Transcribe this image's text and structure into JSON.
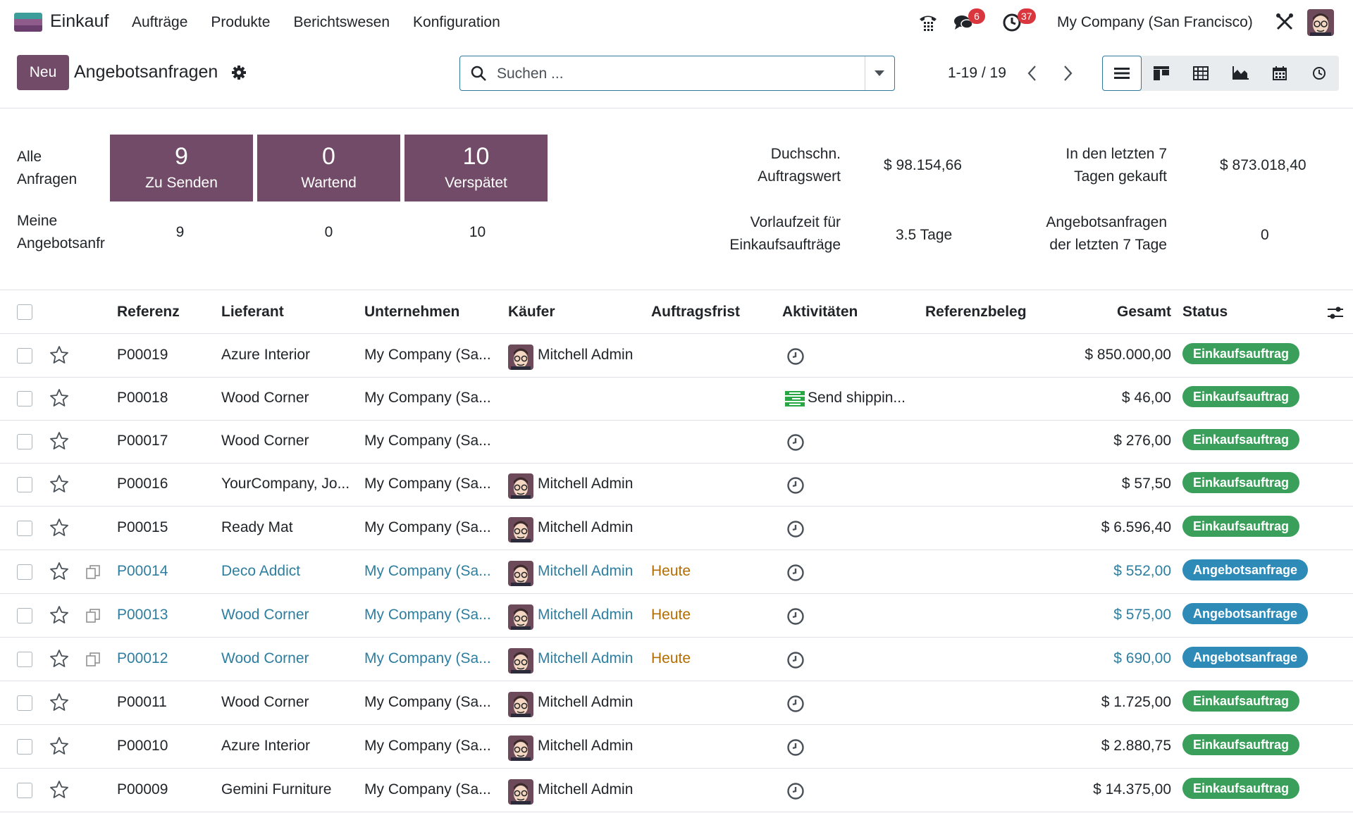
{
  "navbar": {
    "app_name": "Einkauf",
    "menu": [
      "Aufträge",
      "Produkte",
      "Berichtswesen",
      "Konfiguration"
    ],
    "chat_badge": "6",
    "activity_badge": "37",
    "company": "My Company (San Francisco)"
  },
  "control": {
    "new_label": "Neu",
    "title": "Angebotsanfragen",
    "search_placeholder": "Suchen ...",
    "pager": "1-19 / 19",
    "views": [
      "list-view-icon",
      "kanban-view-icon",
      "pivot-view-icon",
      "graph-view-icon",
      "calendar-view-icon",
      "activity-view-icon"
    ]
  },
  "dashboard": {
    "all_label_1": "Alle",
    "all_label_2": "Anfragen",
    "mine_label_1": "Meine",
    "mine_label_2": "Angebotsanfr",
    "tiles": [
      {
        "value": "9",
        "label": "Zu Senden"
      },
      {
        "value": "0",
        "label": "Wartend"
      },
      {
        "value": "10",
        "label": "Verspätet"
      }
    ],
    "mine_values": [
      "9",
      "0",
      "10"
    ],
    "kpis": {
      "avg_label_1": "Duchschn.",
      "avg_label_2": "Auftragswert",
      "avg_value": "$ 98.154,66",
      "bought_label_1": "In den letzten 7",
      "bought_label_2": "Tagen gekauft",
      "bought_value": "$ 873.018,40",
      "lead_label_1": "Vorlaufzeit für",
      "lead_label_2": "Einkaufsaufträge",
      "lead_value": "3.5 Tage",
      "rfq7_label_1": "Angebotsanfragen",
      "rfq7_label_2": "der letzten 7 Tage",
      "rfq7_value": "0"
    }
  },
  "table": {
    "headers": {
      "ref": "Referenz",
      "vendor": "Lieferant",
      "company": "Unternehmen",
      "buyer": "Käufer",
      "deadline": "Auftragsfrist",
      "activities": "Aktivitäten",
      "source": "Referenzbeleg",
      "total": "Gesamt",
      "status": "Status"
    },
    "rows": [
      {
        "ref": "P00019",
        "vendor": "Azure Interior",
        "company": "My Company (Sa...",
        "buyer": "Mitchell Admin",
        "deadline": "",
        "activity": "",
        "total": "$ 850.000,00",
        "status": "Einkaufsauftrag",
        "draft": false
      },
      {
        "ref": "P00018",
        "vendor": "Wood Corner",
        "company": "My Company (Sa...",
        "buyer": "",
        "deadline": "",
        "activity": "Send shippin...",
        "total": "$ 46,00",
        "status": "Einkaufsauftrag",
        "draft": false
      },
      {
        "ref": "P00017",
        "vendor": "Wood Corner",
        "company": "My Company (Sa...",
        "buyer": "",
        "deadline": "",
        "activity": "",
        "total": "$ 276,00",
        "status": "Einkaufsauftrag",
        "draft": false
      },
      {
        "ref": "P00016",
        "vendor": "YourCompany, Jo...",
        "company": "My Company (Sa...",
        "buyer": "Mitchell Admin",
        "deadline": "",
        "activity": "",
        "total": "$ 57,50",
        "status": "Einkaufsauftrag",
        "draft": false
      },
      {
        "ref": "P00015",
        "vendor": "Ready Mat",
        "company": "My Company (Sa...",
        "buyer": "Mitchell Admin",
        "deadline": "",
        "activity": "",
        "total": "$ 6.596,40",
        "status": "Einkaufsauftrag",
        "draft": false
      },
      {
        "ref": "P00014",
        "vendor": "Deco Addict",
        "company": "My Company (Sa...",
        "buyer": "Mitchell Admin",
        "deadline": "Heute",
        "activity": "",
        "total": "$ 552,00",
        "status": "Angebotsanfrage",
        "draft": true
      },
      {
        "ref": "P00013",
        "vendor": "Wood Corner",
        "company": "My Company (Sa...",
        "buyer": "Mitchell Admin",
        "deadline": "Heute",
        "activity": "",
        "total": "$ 575,00",
        "status": "Angebotsanfrage",
        "draft": true
      },
      {
        "ref": "P00012",
        "vendor": "Wood Corner",
        "company": "My Company (Sa...",
        "buyer": "Mitchell Admin",
        "deadline": "Heute",
        "activity": "",
        "total": "$ 690,00",
        "status": "Angebotsanfrage",
        "draft": true
      },
      {
        "ref": "P00011",
        "vendor": "Wood Corner",
        "company": "My Company (Sa...",
        "buyer": "Mitchell Admin",
        "deadline": "",
        "activity": "",
        "total": "$ 1.725,00",
        "status": "Einkaufsauftrag",
        "draft": false
      },
      {
        "ref": "P00010",
        "vendor": "Azure Interior",
        "company": "My Company (Sa...",
        "buyer": "Mitchell Admin",
        "deadline": "",
        "activity": "",
        "total": "$ 2.880,75",
        "status": "Einkaufsauftrag",
        "draft": false
      },
      {
        "ref": "P00009",
        "vendor": "Gemini Furniture",
        "company": "My Company (Sa...",
        "buyer": "Mitchell Admin",
        "deadline": "",
        "activity": "",
        "total": "$ 14.375,00",
        "status": "Einkaufsauftrag",
        "draft": false
      }
    ]
  },
  "colors": {
    "brand": "#714b67",
    "link": "#2e7ea0",
    "deadline": "#b36d00",
    "status_po": "#3a9f5a",
    "status_rfq": "#2e8bb8"
  }
}
